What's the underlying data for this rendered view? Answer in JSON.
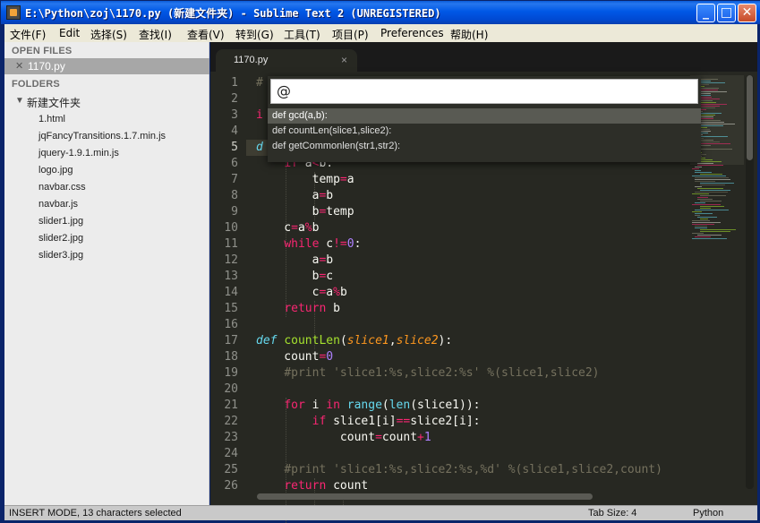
{
  "window": {
    "title": "E:\\Python\\zoj\\1170.py (新建文件夹) - Sublime Text 2 (UNREGISTERED)",
    "minimize": "_",
    "maximize": "□",
    "close": "✕"
  },
  "menu": [
    "文件(F)",
    "Edit",
    "选择(S)",
    "查找(I)",
    "查看(V)",
    "转到(G)",
    "工具(T)",
    "项目(P)",
    "Preferences",
    "帮助(H)"
  ],
  "sidebar": {
    "open_files_header": "OPEN FILES",
    "open_file": "1170.py",
    "folders_header": "FOLDERS",
    "folder": "新建文件夹",
    "files": [
      "1.html",
      "jqFancyTransitions.1.7.min.js",
      "jquery-1.9.1.min.js",
      "logo.jpg",
      "navbar.css",
      "navbar.js",
      "slider1.jpg",
      "slider2.jpg",
      "slider3.jpg"
    ]
  },
  "tab": {
    "label": "1170.py",
    "close": "×"
  },
  "goto_symbol": {
    "query": "@",
    "items": [
      "def gcd(a,b):",
      "def countLen(slice1,slice2):",
      "def getCommonlen(str1,str2):"
    ],
    "selected_index": 0
  },
  "editor": {
    "line_numbers": [
      "1",
      "2",
      "3",
      "4",
      "5",
      "6",
      "7",
      "8",
      "9",
      "10",
      "11",
      "12",
      "13",
      "14",
      "15",
      "16",
      "17",
      "18",
      "19",
      "20",
      "21",
      "22",
      "23",
      "24",
      "25",
      "26"
    ],
    "active_line": 5
  },
  "status": {
    "mode": "INSERT MODE, 13 characters selected",
    "tab_size": "Tab Size: 4",
    "syntax": "Python"
  },
  "colors": {
    "editor_bg": "#272822",
    "keyword": "#f92672",
    "function": "#a6e22e",
    "parameter": "#fd971f",
    "number": "#ae81ff",
    "comment": "#75715e"
  }
}
